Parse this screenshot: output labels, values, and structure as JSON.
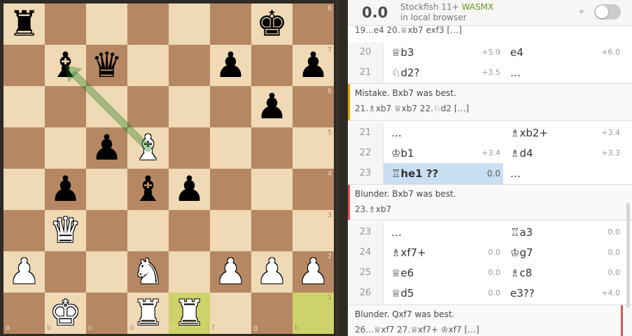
{
  "board": {
    "files": [
      "a",
      "b",
      "c",
      "d",
      "e",
      "f",
      "g",
      "h"
    ],
    "ranks": [
      "8",
      "7",
      "6",
      "5",
      "4",
      "3",
      "2",
      "1"
    ],
    "highlight": [
      "e1",
      "h1"
    ],
    "pieces": [
      {
        "sq": "a8",
        "color": "b",
        "type": "rook",
        "glyph": "♜"
      },
      {
        "sq": "g8",
        "color": "b",
        "type": "king",
        "glyph": "♚"
      },
      {
        "sq": "b7",
        "color": "b",
        "type": "bishop",
        "glyph": "♝"
      },
      {
        "sq": "c7",
        "color": "b",
        "type": "queen",
        "glyph": "♛"
      },
      {
        "sq": "f7",
        "color": "b",
        "type": "pawn",
        "glyph": "♟"
      },
      {
        "sq": "h7",
        "color": "b",
        "type": "pawn",
        "glyph": "♟"
      },
      {
        "sq": "g6",
        "color": "b",
        "type": "pawn",
        "glyph": "♟"
      },
      {
        "sq": "c5",
        "color": "b",
        "type": "pawn",
        "glyph": "♟"
      },
      {
        "sq": "d5",
        "color": "w",
        "type": "bishop",
        "glyph": "♝"
      },
      {
        "sq": "b4",
        "color": "b",
        "type": "pawn",
        "glyph": "♟"
      },
      {
        "sq": "d4",
        "color": "b",
        "type": "bishop",
        "glyph": "♝"
      },
      {
        "sq": "e4",
        "color": "b",
        "type": "pawn",
        "glyph": "♟"
      },
      {
        "sq": "b3",
        "color": "w",
        "type": "queen",
        "glyph": "♛"
      },
      {
        "sq": "a2",
        "color": "w",
        "type": "pawn",
        "glyph": "♟"
      },
      {
        "sq": "d2",
        "color": "w",
        "type": "knight",
        "glyph": "♞"
      },
      {
        "sq": "f2",
        "color": "w",
        "type": "pawn",
        "glyph": "♟"
      },
      {
        "sq": "g2",
        "color": "w",
        "type": "pawn",
        "glyph": "♟"
      },
      {
        "sq": "h2",
        "color": "w",
        "type": "pawn",
        "glyph": "♟"
      },
      {
        "sq": "b1",
        "color": "w",
        "type": "king",
        "glyph": "♚"
      },
      {
        "sq": "d1",
        "color": "w",
        "type": "rook",
        "glyph": "♜"
      },
      {
        "sq": "e1",
        "color": "w",
        "type": "rook",
        "glyph": "♜"
      }
    ],
    "arrow": {
      "from": "d5",
      "to": "b7",
      "color": "#15781B"
    }
  },
  "ceval": {
    "score": "0.0",
    "engine_name": "Stockfish 11+",
    "engine_tag": "WASMX",
    "engine_sub": "in local browser"
  },
  "partial_line": "19...e4 20.♕xb7 exf3 […]",
  "rows": [
    {
      "num": "20",
      "white": "♕b3",
      "white_eval": "+5.9",
      "black": "e4",
      "black_eval": "+6.0"
    },
    {
      "num": "21",
      "white": "♘d2?",
      "white_eval": "+3.5",
      "black": "…",
      "black_eval": ""
    }
  ],
  "comment1": {
    "text": "Mistake. Bxb7 was best.",
    "line": "21.♗xb7 ♕xb7 22.♘d2 […]",
    "color": "#e69f00"
  },
  "rows2": [
    {
      "num": "21",
      "white": "…",
      "white_eval": "",
      "black": "♗xb2+",
      "black_eval": "+3.4"
    },
    {
      "num": "22",
      "white": "♔b1",
      "white_eval": "+3.4",
      "black": "♗d4",
      "black_eval": "+3.3"
    },
    {
      "num": "23",
      "white": "♖he1 ??",
      "white_eval": "0.0",
      "black": "…",
      "black_eval": ""
    }
  ],
  "comment2": {
    "text": "Blunder. Bxb7 was best.",
    "line": "23.♗xb7",
    "color": "#df5353"
  },
  "rows3": [
    {
      "num": "23",
      "white": "…",
      "white_eval": "",
      "black": "♖a3",
      "black_eval": "0.0"
    },
    {
      "num": "24",
      "white": "♗xf7+",
      "white_eval": "0.0",
      "black": "♔g7",
      "black_eval": "0.0"
    },
    {
      "num": "25",
      "white": "♕e6",
      "white_eval": "0.0",
      "black": "♗c8",
      "black_eval": "0.0"
    },
    {
      "num": "26",
      "white": "♕d5",
      "white_eval": "0.0",
      "black": "e3??",
      "black_eval": "+4.0"
    }
  ],
  "comment3": {
    "text": "Blunder. Qxf7 was best.",
    "line": "26...♕xf7 27.♕xf7+ ♔xf7 […]",
    "color": "#df5353"
  }
}
